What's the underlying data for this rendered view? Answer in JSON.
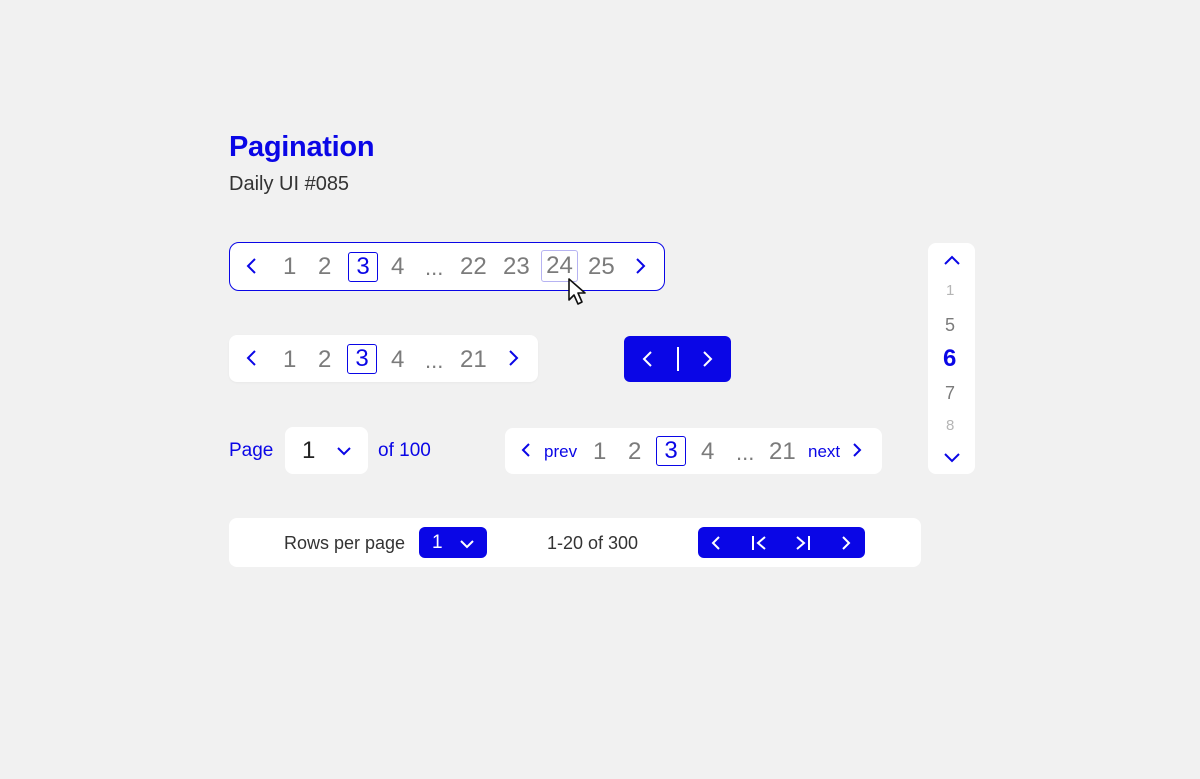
{
  "header": {
    "title": "Pagination",
    "subtitle": "Daily UI #085"
  },
  "pager1": {
    "pages_left": [
      "1",
      "2"
    ],
    "current": "3",
    "after_current": "4",
    "ellipsis": "...",
    "pages_right": [
      "22",
      "23"
    ],
    "hovered": "24",
    "last": "25"
  },
  "pager2": {
    "pages": [
      "1",
      "2"
    ],
    "current": "3",
    "after_current": "4",
    "ellipsis": "...",
    "last": "21"
  },
  "pager3": {
    "icons": [
      "chevron-left-icon",
      "divider",
      "chevron-right-icon"
    ]
  },
  "vertical_pager": {
    "items": [
      "1",
      "5",
      "6",
      "7",
      "8"
    ],
    "current": "6"
  },
  "page_select": {
    "label": "Page",
    "value": "1",
    "of_label": "of 100"
  },
  "pager4": {
    "prev_label": "prev",
    "pages": [
      "1",
      "2"
    ],
    "current": "3",
    "after_current": "4",
    "ellipsis": "...",
    "last": "21",
    "next_label": "next"
  },
  "table_footer": {
    "rows_label": "Rows per page",
    "rows_value": "1",
    "range_label": "1-20 of 300"
  },
  "colors": {
    "accent": "#0a06e6",
    "background": "#f1f1f1",
    "surface": "#ffffff",
    "muted_text": "#7b7b7b"
  }
}
